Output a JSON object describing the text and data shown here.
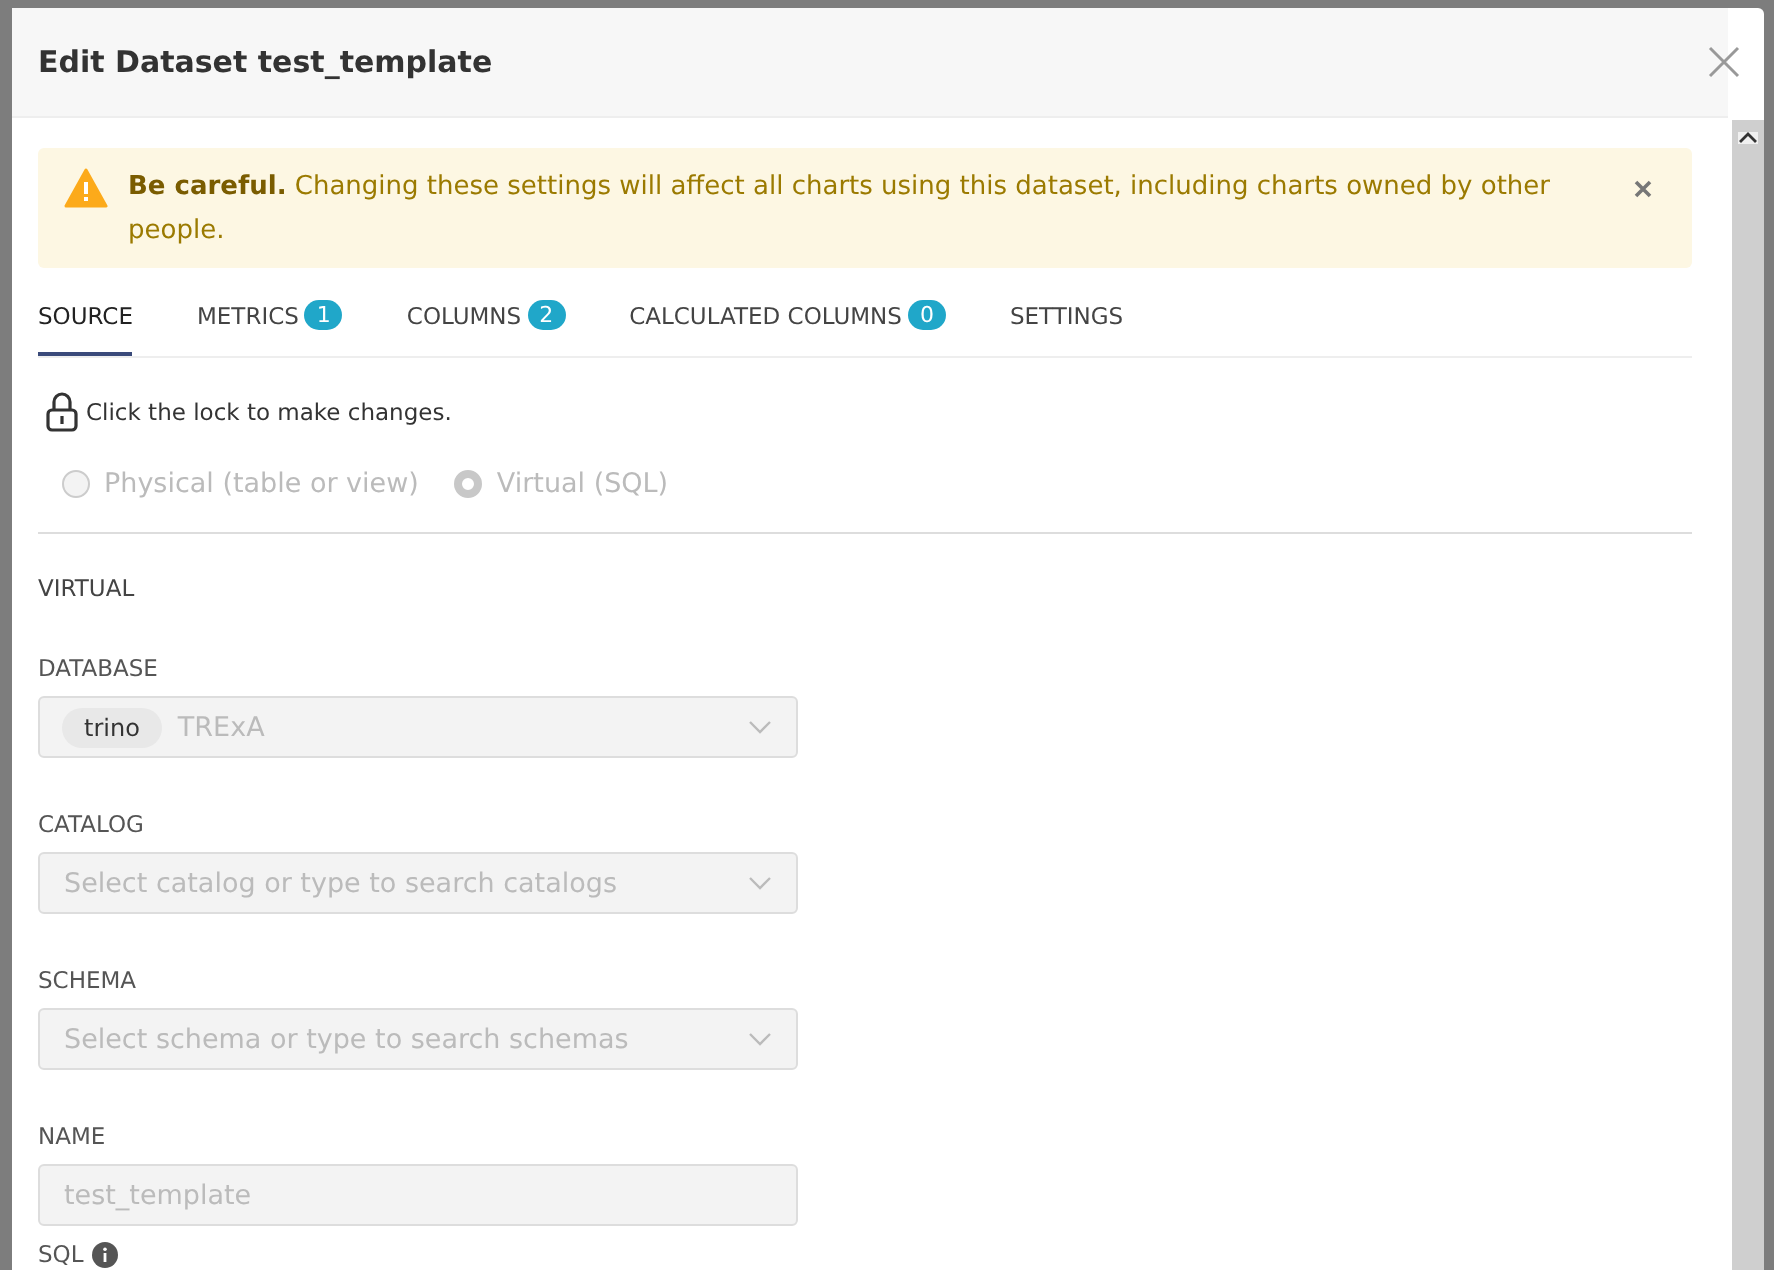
{
  "modal": {
    "title": "Edit Dataset test_template"
  },
  "alert": {
    "bold": "Be careful.",
    "text": "Changing these settings will affect all charts using this dataset, including charts owned by other people."
  },
  "tabs": [
    {
      "label": "SOURCE",
      "selected": true
    },
    {
      "label": "METRICS",
      "badge": "1",
      "selected": false
    },
    {
      "label": "COLUMNS",
      "badge": "2",
      "selected": false
    },
    {
      "label": "CALCULATED COLUMNS",
      "badge": "0",
      "selected": false
    },
    {
      "label": "SETTINGS",
      "selected": false
    }
  ],
  "lock_hint": "Click the lock to make changes.",
  "source_types": [
    {
      "label": "Physical (table or view)",
      "selected": false
    },
    {
      "label": "Virtual (SQL)",
      "selected": true
    }
  ],
  "section_title": "VIRTUAL",
  "fields": [
    {
      "kind": "select",
      "label": "DATABASE",
      "tag": "trino",
      "value": "TRExA"
    },
    {
      "kind": "select",
      "label": "CATALOG",
      "placeholder": "Select catalog or type to search catalogs"
    },
    {
      "kind": "select",
      "label": "SCHEMA",
      "placeholder": "Select schema or type to search schemas"
    },
    {
      "kind": "input",
      "label": "NAME",
      "value": "test_template"
    }
  ],
  "sql_label": "SQL"
}
